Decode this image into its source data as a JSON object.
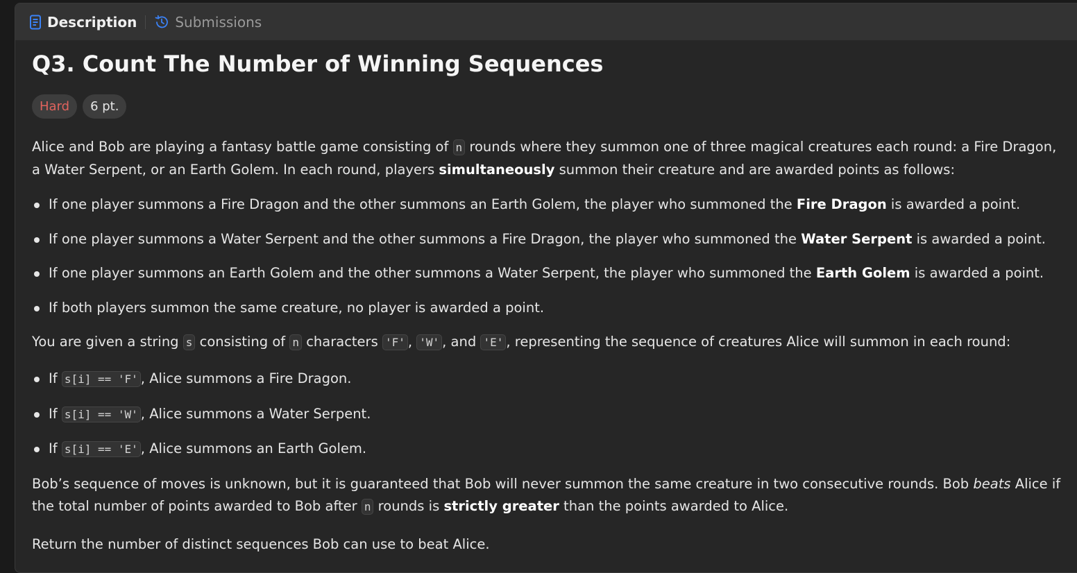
{
  "tabs": {
    "description": "Description",
    "submissions": "Submissions"
  },
  "problem": {
    "title": "Q3. Count The Number of Winning Sequences",
    "difficulty": "Hard",
    "points": "6 pt."
  },
  "colors": {
    "hard": "#e0635d",
    "description_icon": "#3b82f6",
    "submissions_icon": "#3b82f6"
  },
  "icons": {
    "description": "document-icon",
    "submissions": "history-clock-icon"
  },
  "body": {
    "p1_a": "Alice and Bob are playing a fantasy battle game consisting of ",
    "p1_code_n": "n",
    "p1_b": " rounds where they summon one of three magical creatures each round: a Fire Dragon, a Water Serpent, or an Earth Golem. In each round, players ",
    "p1_bold": "simultaneously",
    "p1_c": " summon their creature and are awarded points as follows:",
    "rules": [
      {
        "pre": "If one player summons a Fire Dragon and the other summons an Earth Golem, the player who summoned the ",
        "bold": "Fire Dragon",
        "post": " is awarded a point."
      },
      {
        "pre": "If one player summons a Water Serpent and the other summons a Fire Dragon, the player who summoned the ",
        "bold": "Water Serpent",
        "post": " is awarded a point."
      },
      {
        "pre": "If one player summons an Earth Golem and the other summons a Water Serpent, the player who summoned the ",
        "bold": "Earth Golem",
        "post": " is awarded a point."
      },
      {
        "pre": "If both players summon the same creature, no player is awarded a point.",
        "bold": "",
        "post": ""
      }
    ],
    "p2_a": "You are given a string ",
    "p2_code_s": "s",
    "p2_b": " consisting of ",
    "p2_code_n": "n",
    "p2_c": " characters ",
    "p2_code_f": "'F'",
    "p2_d": ", ",
    "p2_code_w": "'W'",
    "p2_e": ", and ",
    "p2_code_e": "'E'",
    "p2_f": ", representing the sequence of creatures Alice will summon in each round:",
    "mappings": [
      {
        "pre": "If ",
        "code": "s[i] == 'F'",
        "post": ", Alice summons a Fire Dragon."
      },
      {
        "pre": "If ",
        "code": "s[i] == 'W'",
        "post": ", Alice summons a Water Serpent."
      },
      {
        "pre": "If ",
        "code": "s[i] == 'E'",
        "post": ", Alice summons an Earth Golem."
      }
    ],
    "p3_a": "Bob’s sequence of moves is unknown, but it is guaranteed that Bob will never summon the same creature in two consecutive rounds. Bob ",
    "p3_em": "beats",
    "p3_b": " Alice if the total number of points awarded to Bob after ",
    "p3_code_n": "n",
    "p3_c": " rounds is ",
    "p3_bold": "strictly greater",
    "p3_d": " than the points awarded to Alice.",
    "p4": "Return the number of distinct sequences Bob can use to beat Alice."
  }
}
